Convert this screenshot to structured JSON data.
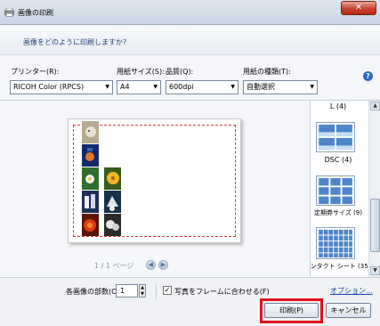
{
  "window": {
    "title": "画像の印刷",
    "close_label": "✕"
  },
  "question": "画像をどのように印刷しますか?",
  "options": {
    "printer": {
      "label": "プリンター(R):",
      "value": "RICOH Color (RPCS)"
    },
    "paper_size": {
      "label": "用紙サイズ(S):",
      "value": "A4"
    },
    "quality": {
      "label": "品質(Q):",
      "value": "600dpi"
    },
    "paper_type": {
      "label": "用紙の種類(T):",
      "value": "自動選択"
    }
  },
  "preview": {
    "pager": "1 / 1 ページ"
  },
  "layouts": [
    {
      "label": "L (4)"
    },
    {
      "label": "DSC (4)"
    },
    {
      "label": "定期券サイズ (9)"
    },
    {
      "label": "コンタクト シート (35)"
    }
  ],
  "bottom": {
    "copies_label": "各画像の部数(C):",
    "copies_value": "1",
    "fit_label": "写真をフレームに合わせる(F)",
    "fit_checked": true,
    "options_link": "オプション...",
    "print_label": "印刷(P)",
    "cancel_label": "キャンセル"
  },
  "colors": {
    "highlight": "#e0101a",
    "accent": "#2c68c8"
  }
}
